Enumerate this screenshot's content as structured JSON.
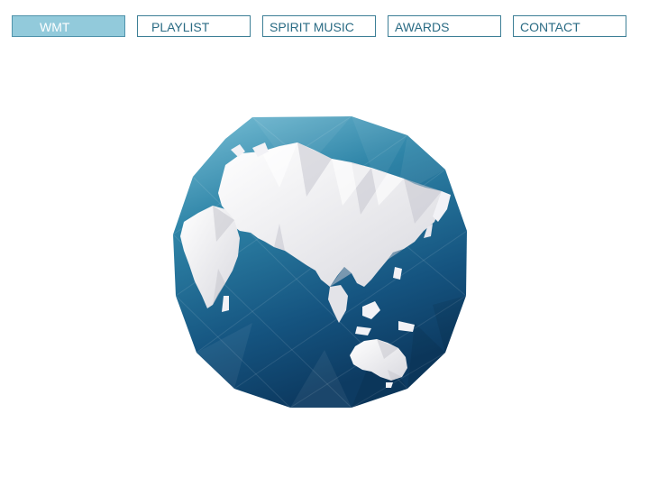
{
  "nav": {
    "items": [
      {
        "label": "WMT",
        "active": true
      },
      {
        "label": "PLAYLIST",
        "active": false
      },
      {
        "label": "SPIRIT MUSIC",
        "active": false
      },
      {
        "label": "AWARDS",
        "active": false
      },
      {
        "label": "CONTACT",
        "active": false
      }
    ]
  },
  "colors": {
    "nav_active_bg": "#92cadb",
    "nav_border": "#3d7f96",
    "nav_text": "#2a6b84",
    "ocean_light": "#6cb7cf",
    "ocean_dark": "#0d3b62",
    "land": "#eeeef2"
  },
  "hero": {
    "image": "low-poly-globe-icon"
  }
}
